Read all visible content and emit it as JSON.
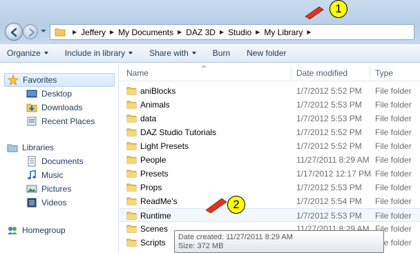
{
  "address": {
    "crumbs": [
      "Jeffery",
      "My Documents",
      "DAZ 3D",
      "Studio",
      "My Library"
    ]
  },
  "toolbar": {
    "organize": "Organize",
    "include": "Include in library",
    "share": "Share with",
    "burn": "Burn",
    "new_folder": "New folder"
  },
  "nav": {
    "favorites": "Favorites",
    "desktop": "Desktop",
    "downloads": "Downloads",
    "recent": "Recent Places",
    "libraries": "Libraries",
    "documents": "Documents",
    "music": "Music",
    "pictures": "Pictures",
    "videos": "Videos",
    "homegroup": "Homegroup"
  },
  "columns": {
    "name": "Name",
    "date": "Date modified",
    "type": "Type"
  },
  "files": [
    {
      "name": "aniBlocks",
      "date": "1/7/2012 5:52 PM",
      "type": "File folder"
    },
    {
      "name": "Animals",
      "date": "1/7/2012 5:53 PM",
      "type": "File folder"
    },
    {
      "name": "data",
      "date": "1/7/2012 5:53 PM",
      "type": "File folder"
    },
    {
      "name": "DAZ Studio Tutorials",
      "date": "1/7/2012 5:52 PM",
      "type": "File folder"
    },
    {
      "name": "Light Presets",
      "date": "1/7/2012 5:52 PM",
      "type": "File folder"
    },
    {
      "name": "People",
      "date": "11/27/2011 8:29 AM",
      "type": "File folder"
    },
    {
      "name": "Presets",
      "date": "1/17/2012 12:17 PM",
      "type": "File folder"
    },
    {
      "name": "Props",
      "date": "1/7/2012 5:53 PM",
      "type": "File folder"
    },
    {
      "name": "ReadMe's",
      "date": "1/7/2012 5:54 PM",
      "type": "File folder"
    },
    {
      "name": "Runtime",
      "date": "1/7/2012 5:53 PM",
      "type": "File folder"
    },
    {
      "name": "Scenes",
      "date": "11/27/2011 8:29 AM",
      "type": "File folder"
    },
    {
      "name": "Scripts",
      "date": "",
      "type": "File folder"
    }
  ],
  "tooltip": {
    "created": "Date created: 11/27/2011 8:29 AM",
    "size": "Size: 372 MB"
  },
  "callouts": {
    "one": "1",
    "two": "2"
  },
  "colors": {
    "callout": "#ffff00",
    "accent": "#1e395b",
    "folder": "#f0c95a"
  }
}
